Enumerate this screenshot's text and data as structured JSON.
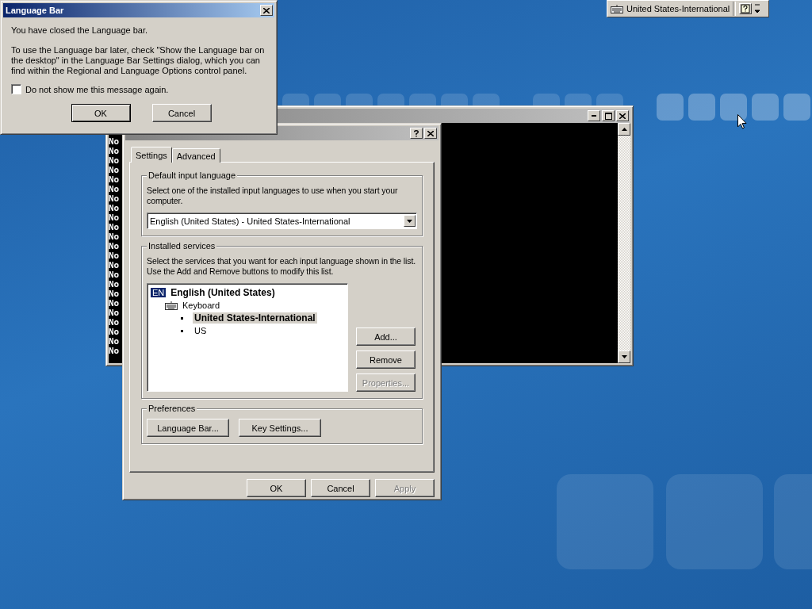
{
  "language_bar_dialog": {
    "title": "Language Bar",
    "message": "You have closed the Language bar.",
    "instructions": "To use the Language bar later, check \"Show the Language bar on the desktop\" in the Language Bar Settings dialog, which you can find within the Regional and Language Options control panel.",
    "checkbox": {
      "label": "Do not show me this message again.",
      "checked": false
    },
    "buttons": [
      "OK",
      "Cancel"
    ]
  },
  "console_window": {
    "lines": [
      "No",
      "No",
      "No",
      "No",
      "No",
      "No",
      "No",
      "No",
      "No",
      "No",
      "No",
      "No",
      "No",
      "No",
      "No",
      "No",
      "No",
      "No",
      "No",
      "No",
      "No",
      "No",
      "No"
    ]
  },
  "settings_dialog": {
    "tabs": [
      {
        "label": "Settings",
        "selected": true
      },
      {
        "label": "Advanced",
        "selected": false
      }
    ],
    "default_input_language": {
      "title": "Default input language",
      "description": "Select one of the installed input languages to use when you start your computer.",
      "value": "English (United States) - United States-International"
    },
    "installed_services": {
      "title": "Installed services",
      "description": "Select the services that you want for each input language shown in the list. Use the Add and Remove buttons to modify this list.",
      "tree": [
        {
          "kind": "language",
          "badge": "EN",
          "label": "English (United States)",
          "children": [
            {
              "kind": "category",
              "label": "Keyboard",
              "children": [
                {
                  "kind": "layout",
                  "label": "United States-International",
                  "selected": true
                },
                {
                  "kind": "layout",
                  "label": "US",
                  "selected": false
                }
              ]
            }
          ]
        }
      ],
      "buttons": [
        {
          "label": "Add...",
          "disabled": false
        },
        {
          "label": "Remove",
          "disabled": false
        },
        {
          "label": "Properties...",
          "disabled": true
        }
      ]
    },
    "preferences": {
      "title": "Preferences",
      "buttons": [
        "Language Bar...",
        "Key Settings..."
      ]
    },
    "footer_buttons": [
      {
        "label": "OK",
        "disabled": false
      },
      {
        "label": "Cancel",
        "disabled": false
      },
      {
        "label": "Apply",
        "disabled": true
      }
    ]
  },
  "language_band": {
    "layout": "United States-International"
  }
}
